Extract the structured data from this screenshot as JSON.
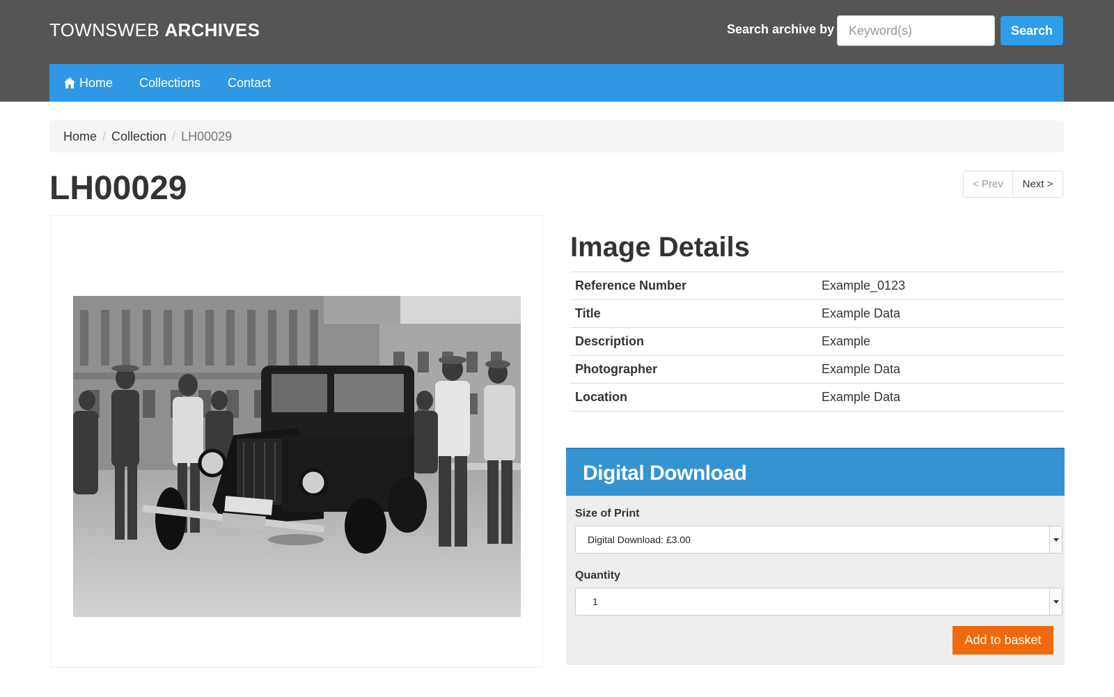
{
  "header": {
    "brand_light": "TOWNSWEB",
    "brand_bold": "ARCHIVES",
    "search_label": "Search archive by",
    "search_placeholder": "Keyword(s)",
    "search_button": "Search"
  },
  "nav": {
    "home": "Home",
    "collections": "Collections",
    "contact": "Contact",
    "home_icon": "home-icon"
  },
  "breadcrumb": {
    "items": [
      "Home",
      "Collection"
    ],
    "current": "LH00029",
    "separator": "/"
  },
  "page": {
    "title": "LH00029",
    "prev": "< Prev",
    "next": "Next >"
  },
  "details": {
    "heading": "Image Details",
    "rows": [
      {
        "label": "Reference Number",
        "value": "Example_0123"
      },
      {
        "label": "Title",
        "value": "Example Data"
      },
      {
        "label": "Description",
        "value": "Example"
      },
      {
        "label": "Photographer",
        "value": "Example Data"
      },
      {
        "label": "Location",
        "value": "Example Data"
      }
    ]
  },
  "download": {
    "heading": "Digital Download",
    "size_label": "Size of Print",
    "size_value": "Digital Download: £3.00",
    "quantity_label": "Quantity",
    "quantity_value": "1",
    "add_button": "Add to basket"
  },
  "colors": {
    "header_bg": "#555555",
    "nav_bg": "#2f98e6",
    "search_button": "#2d9ee8",
    "download_head": "#3593d2",
    "add_button": "#ef6a0a"
  }
}
